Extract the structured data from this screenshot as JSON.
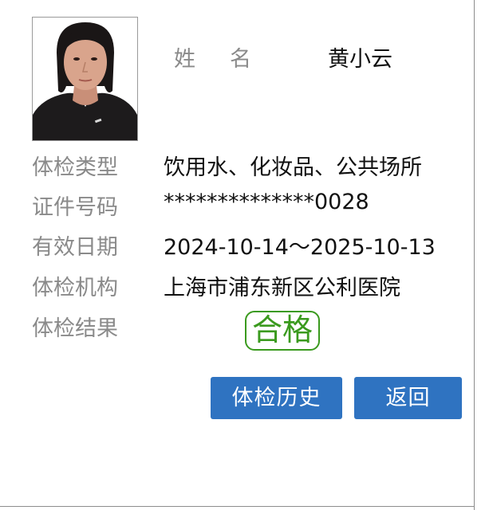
{
  "profile": {
    "name_label_chars": [
      "姓",
      "名"
    ],
    "name": "黄小云"
  },
  "rows": [
    {
      "label": "体检类型",
      "value": "饮用水、化妆品、公共场所"
    },
    {
      "label": "证件号码",
      "value": "**************0028"
    },
    {
      "label": "有效日期",
      "value": "2024-10-14～2025-10-13"
    },
    {
      "label": "体检机构",
      "value": "上海市浦东新区公利医院"
    },
    {
      "label": "体检结果",
      "value": ""
    }
  ],
  "result": {
    "stamp_text": "合格",
    "stamp_color": "#3a9a1e"
  },
  "actions": {
    "history_label": "体检历史",
    "back_label": "返回",
    "button_color": "#2f73c1"
  }
}
